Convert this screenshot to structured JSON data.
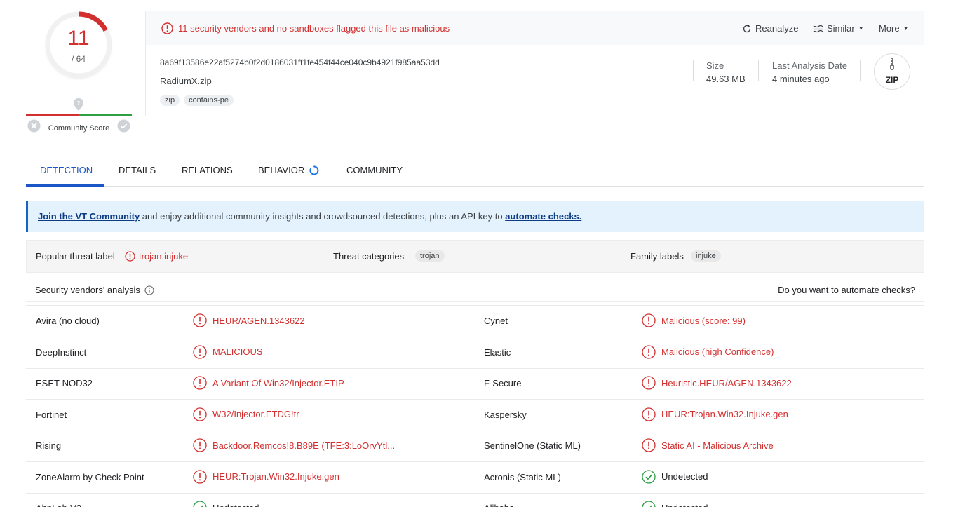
{
  "score": {
    "detections": "11",
    "total": "/ 64",
    "ratio": 0.171875,
    "community_label": "Community Score"
  },
  "alert": {
    "text": "11 security vendors and no sandboxes flagged this file as malicious"
  },
  "actions": {
    "reanalyze": "Reanalyze",
    "similar": "Similar",
    "more": "More"
  },
  "file": {
    "hash": "8a69f13586e22af5274b0f2d0186031ff1fe454f44ce040c9b4921f985aa53dd",
    "name": "RadiumX.zip",
    "tags": [
      "zip",
      "contains-pe"
    ],
    "size_label": "Size",
    "size_value": "49.63 MB",
    "date_label": "Last Analysis Date",
    "date_value": "4 minutes ago",
    "type_icon": "ZIP"
  },
  "tabs": [
    "DETECTION",
    "DETAILS",
    "RELATIONS",
    "BEHAVIOR",
    "COMMUNITY"
  ],
  "banner": {
    "link1": "Join the VT Community",
    "middle": " and enjoy additional community insights and crowdsourced detections, plus an API key to ",
    "link2": "automate checks."
  },
  "threat": {
    "popular_label": "Popular threat label",
    "popular_value": "trojan.injuke",
    "categories_label": "Threat categories",
    "categories_value": "trojan",
    "family_label": "Family labels",
    "family_value": "injuke"
  },
  "vendors_header": {
    "title": "Security vendors' analysis",
    "automate": "Do you want to automate checks?"
  },
  "vendors": [
    {
      "left_name": "Avira (no cloud)",
      "left_result": "HEUR/AGEN.1343622",
      "left_status": "malicious",
      "right_name": "Cynet",
      "right_result": "Malicious (score: 99)",
      "right_status": "malicious"
    },
    {
      "left_name": "DeepInstinct",
      "left_result": "MALICIOUS",
      "left_status": "malicious",
      "right_name": "Elastic",
      "right_result": "Malicious (high Confidence)",
      "right_status": "malicious"
    },
    {
      "left_name": "ESET-NOD32",
      "left_result": "A Variant Of Win32/Injector.ETIP",
      "left_status": "malicious",
      "right_name": "F-Secure",
      "right_result": "Heuristic.HEUR/AGEN.1343622",
      "right_status": "malicious"
    },
    {
      "left_name": "Fortinet",
      "left_result": "W32/Injector.ETDG!tr",
      "left_status": "malicious",
      "right_name": "Kaspersky",
      "right_result": "HEUR:Trojan.Win32.Injuke.gen",
      "right_status": "malicious"
    },
    {
      "left_name": "Rising",
      "left_result": "Backdoor.Remcos!8.B89E (TFE:3:LoOrvYtl...",
      "left_status": "malicious",
      "right_name": "SentinelOne (Static ML)",
      "right_result": "Static AI - Malicious Archive",
      "right_status": "malicious"
    },
    {
      "left_name": "ZoneAlarm by Check Point",
      "left_result": "HEUR:Trojan.Win32.Injuke.gen",
      "left_status": "malicious",
      "right_name": "Acronis (Static ML)",
      "right_result": "Undetected",
      "right_status": "undetected"
    },
    {
      "left_name": "AhnLab-V3",
      "left_result": "Undetected",
      "left_status": "undetected",
      "right_name": "Alibaba",
      "right_result": "Undetected",
      "right_status": "undetected"
    }
  ],
  "colors": {
    "malicious": "#d32f2f",
    "clean": "#2e9f44",
    "accent": "#1a56c6"
  }
}
